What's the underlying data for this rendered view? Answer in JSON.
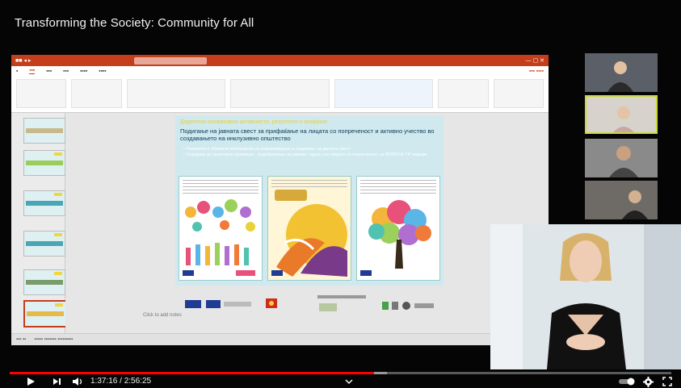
{
  "video": {
    "title": "Transforming the Society: Community for All",
    "time_current": "1:37:16",
    "time_separator": " / ",
    "time_total": "2:56:25",
    "progress": 0.551,
    "buffered": 0.57
  },
  "colors": {
    "ppt_accent": "#c43e1c",
    "progress": "#ff0000",
    "active_speaker": "#c8d83b",
    "slide_bg": "#cfe9ef"
  },
  "icons": {
    "play": "play-icon",
    "next": "next-icon",
    "volume": "volume-icon",
    "chevron": "chevron-down-icon",
    "autoplay": "autoplay-toggle",
    "settings": "gear-icon",
    "fullscreen": "fullscreen-icon"
  },
  "slide": {
    "heading_yellow": "Доделени иновативни активности, резултати и влијание",
    "heading_main": "Подигање на јавната свест за прифаќање на лицата со попреченост и активно учество во создавањето на инклузивно општество",
    "bullets": [
      "• Развиени и објавени материјали за информирање и подигање на јавната свест",
      "• Серијали за позитивни приказни - подобрување на јавниот однос кон лицата со попреченост за ВОЛИСА ТИ видови"
    ],
    "add_notes": "Click to add notes"
  },
  "participants": [
    {
      "name": ""
    },
    {
      "name": ""
    },
    {
      "name": ""
    },
    {
      "name": ""
    }
  ]
}
